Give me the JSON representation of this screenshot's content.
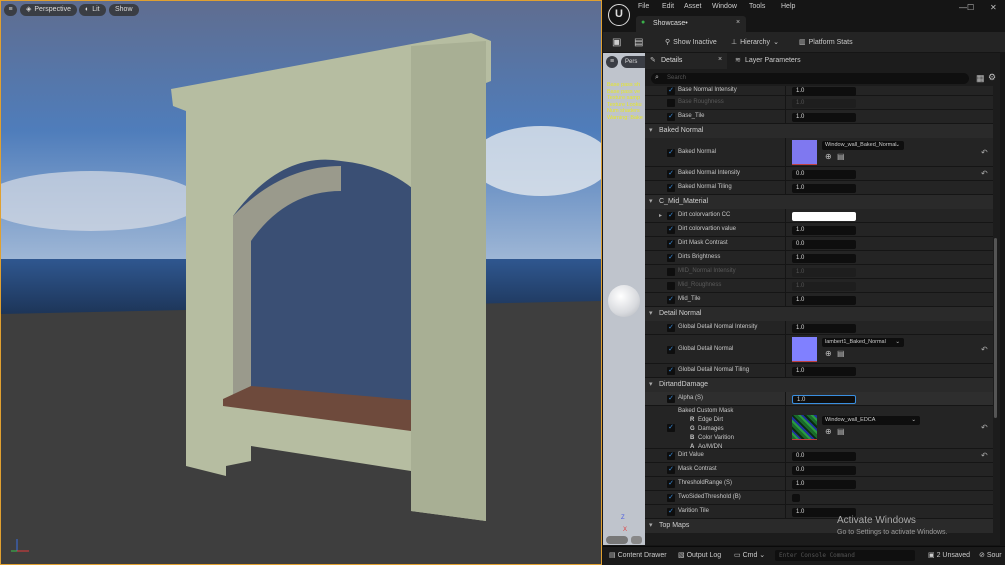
{
  "viewport": {
    "menu_icon": "hamburger-icon",
    "perspective": "Perspective",
    "lit": "Lit",
    "show": "Show"
  },
  "window": {
    "menu": [
      "File",
      "Edit",
      "Asset",
      "Window",
      "Tools",
      "Help"
    ],
    "tab": "Showcase•",
    "controls": [
      "—",
      "☐",
      "✕"
    ]
  },
  "toolbar": {
    "show_inactive": "Show Inactive",
    "hierarchy": "Hierarchy",
    "platform_stats": "Platform Stats"
  },
  "preview": {
    "view_label": "Pers",
    "debug": [
      "Base pass sh",
      "Base pass ve",
      "Texture samp",
      "Texture Looku",
      "Num shaders",
      "Warning: Bake"
    ],
    "axes": {
      "z": "Z",
      "x": "X"
    }
  },
  "details": {
    "tab": "Details",
    "layer_tab": "Layer Parameters",
    "search_placeholder": "Search",
    "rows": [
      {
        "type": "prop",
        "name": "Base Normal Intensity",
        "value": "1.0",
        "checked": true,
        "h": 10
      },
      {
        "type": "prop",
        "name": "Base Roughness",
        "value": "1.0",
        "checked": false,
        "disabled": true
      },
      {
        "type": "prop",
        "name": "Base_Tile",
        "value": "1.0",
        "checked": true
      },
      {
        "type": "group",
        "name": "Baked Normal"
      },
      {
        "type": "tex",
        "name": "Baked Normal",
        "asset": "Window_wall_Baked_Normal",
        "thumb": "#7f78f0",
        "checked": true,
        "reset": true
      },
      {
        "type": "prop",
        "name": "Baked Normal Intensity",
        "value": "0.0",
        "checked": true,
        "reset": true
      },
      {
        "type": "prop",
        "name": "Baked Normal Tiling",
        "value": "1.0",
        "checked": true
      },
      {
        "type": "group",
        "name": "C_Mid_Material"
      },
      {
        "type": "color",
        "name": "Dirt colorvartion CC",
        "color": "#ffffff",
        "checked": true
      },
      {
        "type": "prop",
        "name": "Dirt colorvartion value",
        "value": "1.0",
        "checked": true
      },
      {
        "type": "prop",
        "name": "Dirt Mask Contrast",
        "value": "0.0",
        "checked": true
      },
      {
        "type": "prop",
        "name": "Dirts Brightness",
        "value": "1.0",
        "checked": true
      },
      {
        "type": "prop",
        "name": "MID_Normal Intensity",
        "value": "1.0",
        "checked": false,
        "disabled": true
      },
      {
        "type": "prop",
        "name": "Mid_Roughness",
        "value": "1.0",
        "checked": false,
        "disabled": true
      },
      {
        "type": "prop",
        "name": "Mid_Tile",
        "value": "1.0",
        "checked": true
      },
      {
        "type": "group",
        "name": "Detail Normal"
      },
      {
        "type": "prop",
        "name": "Global Detail  Normal Intensity",
        "value": "1.0",
        "checked": true
      },
      {
        "type": "tex",
        "name": "Global Detail Normal",
        "asset": "lambert1_Baked_Normal",
        "thumb": "#8080ff",
        "checked": true,
        "reset": true
      },
      {
        "type": "prop",
        "name": "Global Detail Normal Tiling",
        "value": "1.0",
        "checked": true
      },
      {
        "type": "group",
        "name": "DirtandDamage"
      },
      {
        "type": "prop",
        "name": "Alpha (S)",
        "value": "1.0",
        "checked": true,
        "active": true
      },
      {
        "type": "mask",
        "name": "Baked Custom Mask",
        "channels": [
          [
            "R",
            "Edge Dirt"
          ],
          [
            "G",
            "Damages"
          ],
          [
            "B",
            "Color Varition"
          ],
          [
            "A",
            "Ao/M/DN"
          ]
        ],
        "asset": "Window_wall_EDCA",
        "checked": true,
        "reset": true
      },
      {
        "type": "prop",
        "name": "Dirt Value",
        "value": "0.0",
        "checked": true,
        "reset": true
      },
      {
        "type": "prop",
        "name": "Mask Contrast",
        "value": "0.0",
        "checked": true
      },
      {
        "type": "prop",
        "name": "ThresholdRange (S)",
        "value": "1.0",
        "checked": true
      },
      {
        "type": "bool",
        "name": "TwoSidedThreshold (B)",
        "checked": true,
        "value": false
      },
      {
        "type": "prop",
        "name": "Varition Tile",
        "value": "1.0",
        "checked": true
      },
      {
        "type": "group",
        "name": "Top Maps"
      }
    ]
  },
  "watermark": {
    "title": "Activate Windows",
    "subtitle": "Go to Settings to activate Windows."
  },
  "status": {
    "content_drawer": "Content Drawer",
    "output_log": "Output Log",
    "cmd": "Cmd",
    "console_placeholder": "Enter Console Command",
    "unsaved": "2 Unsaved",
    "source": "Sour"
  },
  "colors": {
    "accent": "#3a8fe0",
    "viewport_border": "#e0a030",
    "wall": "#b7bea3",
    "sill": "#6e4a3c"
  }
}
